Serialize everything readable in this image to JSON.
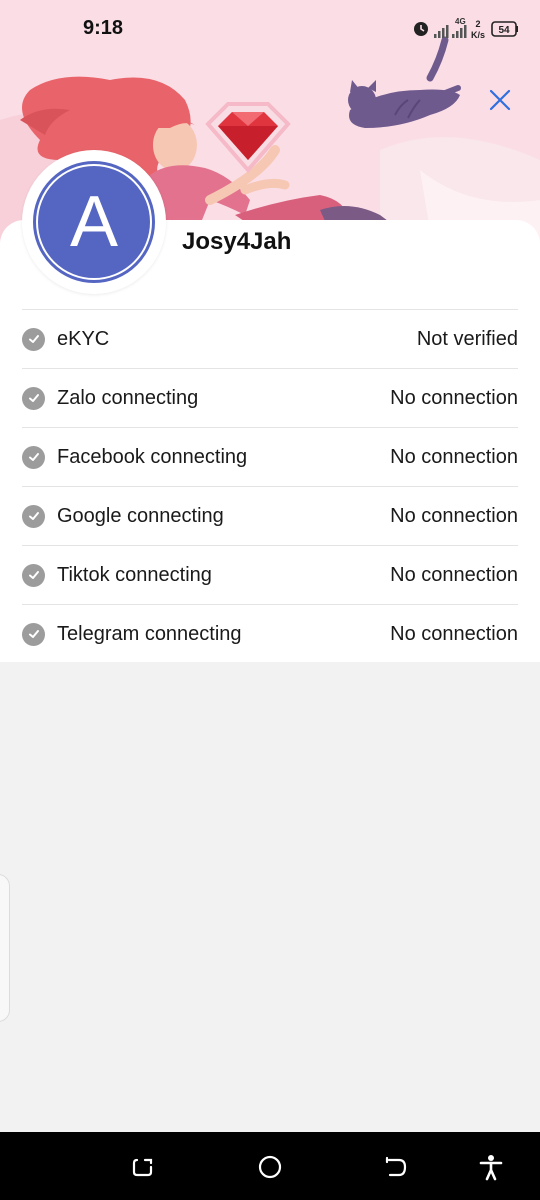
{
  "status_bar": {
    "time": "9:18",
    "network_type": "4G",
    "speed_value": "2",
    "speed_unit": "K/s",
    "battery": "54",
    "icons": [
      "alarm-icon",
      "signal-icon",
      "signal-4g-icon",
      "network-speed",
      "battery-icon"
    ]
  },
  "header": {
    "close_icon": "close-icon",
    "accent_color": "#2f6fe0"
  },
  "profile": {
    "avatar_letter": "A",
    "avatar_color": "#5566c2",
    "username": "Josy4Jah"
  },
  "verification_items": [
    {
      "label": "eKYC",
      "status": "Not verified",
      "icon": "check-circle-icon"
    },
    {
      "label": "Zalo connecting",
      "status": "No connection",
      "icon": "check-circle-icon"
    },
    {
      "label": "Facebook connecting",
      "status": "No connection",
      "icon": "check-circle-icon"
    },
    {
      "label": "Google connecting",
      "status": "No connection",
      "icon": "check-circle-icon"
    },
    {
      "label": "Tiktok connecting",
      "status": "No connection",
      "icon": "check-circle-icon"
    },
    {
      "label": "Telegram connecting",
      "status": "No connection",
      "icon": "check-circle-icon"
    }
  ],
  "nav_bar": {
    "icons": [
      "recents-icon",
      "home-icon",
      "back-icon",
      "accessibility-icon"
    ]
  }
}
